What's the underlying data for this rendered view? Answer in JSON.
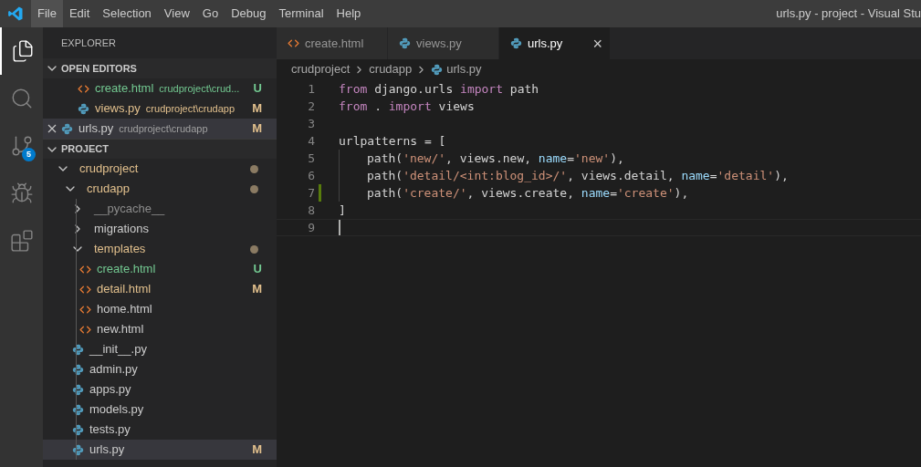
{
  "menu": [
    {
      "label": "File",
      "selected": true
    },
    {
      "label": "Edit",
      "selected": false
    },
    {
      "label": "Selection",
      "selected": false
    },
    {
      "label": "View",
      "selected": false
    },
    {
      "label": "Go",
      "selected": false
    },
    {
      "label": "Debug",
      "selected": false
    },
    {
      "label": "Terminal",
      "selected": false
    },
    {
      "label": "Help",
      "selected": false
    }
  ],
  "window": {
    "title": "urls.py - project - Visual Stu"
  },
  "activity": [
    {
      "kind": "files",
      "selected": true
    },
    {
      "kind": "search",
      "selected": false
    },
    {
      "kind": "scm",
      "selected": false,
      "badge": "5"
    },
    {
      "kind": "debug",
      "selected": false
    },
    {
      "kind": "extensions",
      "selected": false
    }
  ],
  "explorer": {
    "title": "EXPLORER",
    "open_editors": {
      "title": "OPEN EDITORS",
      "expanded": true,
      "items": [
        {
          "name": "create.html",
          "path": "crudproject\\crud...",
          "kind": "html",
          "color": "#73c991",
          "badge": "U",
          "selected": false,
          "closable": false
        },
        {
          "name": "views.py",
          "path": "crudproject\\crudapp",
          "kind": "python",
          "color": "#e2c08d",
          "badge": "M",
          "selected": false,
          "closable": false
        },
        {
          "name": "urls.py",
          "path": "crudproject\\crudapp",
          "kind": "python",
          "color": "#cccccc",
          "badge": "M",
          "selected": true,
          "closable": true
        }
      ]
    },
    "project": {
      "title": "PROJECT",
      "expanded": true,
      "tree": [
        {
          "name": "crudproject",
          "kind": "folder",
          "expanded": true,
          "color": "#e2c08d",
          "dot": true,
          "selected": false,
          "children": [
            {
              "name": "crudapp",
              "kind": "folder",
              "expanded": true,
              "color": "#e2c08d",
              "dot": true,
              "selected": false,
              "children": [
                {
                  "name": "__pycache__",
                  "kind": "folder",
                  "expanded": false,
                  "color": "#8c8c8c",
                  "dot": false,
                  "selected": false
                },
                {
                  "name": "migrations",
                  "kind": "folder",
                  "expanded": false,
                  "color": "#cccccc",
                  "dot": false,
                  "selected": false
                },
                {
                  "name": "templates",
                  "kind": "folder",
                  "expanded": true,
                  "color": "#e2c08d",
                  "dot": true,
                  "selected": false,
                  "children": [
                    {
                      "name": "create.html",
                      "kind": "html",
                      "color": "#73c991",
                      "badge": "U",
                      "selected": false
                    },
                    {
                      "name": "detail.html",
                      "kind": "html",
                      "color": "#e2c08d",
                      "badge": "M",
                      "selected": false
                    },
                    {
                      "name": "home.html",
                      "kind": "html",
                      "color": "#cccccc",
                      "selected": false
                    },
                    {
                      "name": "new.html",
                      "kind": "html",
                      "color": "#cccccc",
                      "selected": false
                    }
                  ]
                },
                {
                  "name": "__init__.py",
                  "kind": "python",
                  "color": "#cccccc",
                  "selected": false
                },
                {
                  "name": "admin.py",
                  "kind": "python",
                  "color": "#cccccc",
                  "selected": false
                },
                {
                  "name": "apps.py",
                  "kind": "python",
                  "color": "#cccccc",
                  "selected": false
                },
                {
                  "name": "models.py",
                  "kind": "python",
                  "color": "#cccccc",
                  "selected": false
                },
                {
                  "name": "tests.py",
                  "kind": "python",
                  "color": "#cccccc",
                  "selected": false
                },
                {
                  "name": "urls.py",
                  "kind": "python",
                  "color": "#cccccc",
                  "badge": "M",
                  "selected": true
                }
              ]
            }
          ]
        }
      ]
    }
  },
  "tabs": [
    {
      "label": "create.html",
      "kind": "html",
      "selected": false
    },
    {
      "label": "views.py",
      "kind": "python",
      "selected": false
    },
    {
      "label": "urls.py",
      "kind": "python",
      "selected": true,
      "close": "×"
    }
  ],
  "breadcrumb": [
    {
      "label": "crudproject",
      "kind": "folder"
    },
    {
      "label": "crudapp",
      "kind": "folder"
    },
    {
      "label": "urls.py",
      "kind": "python"
    }
  ],
  "code": [
    {
      "number": "1",
      "changed": false,
      "indent": false,
      "tokens": [
        {
          "kind": "keyword",
          "text": "from"
        },
        {
          "kind": "plain",
          "text": " django.urls "
        },
        {
          "kind": "keyword",
          "text": "import"
        },
        {
          "kind": "plain",
          "text": " path"
        }
      ]
    },
    {
      "number": "2",
      "changed": false,
      "indent": false,
      "tokens": [
        {
          "kind": "keyword",
          "text": "from"
        },
        {
          "kind": "plain",
          "text": " . "
        },
        {
          "kind": "keyword",
          "text": "import"
        },
        {
          "kind": "plain",
          "text": " views"
        }
      ]
    },
    {
      "number": "3",
      "changed": false,
      "indent": false
    },
    {
      "number": "4",
      "changed": false,
      "indent": false,
      "tokens": [
        {
          "kind": "plain",
          "text": "urlpatterns = ["
        }
      ]
    },
    {
      "number": "5",
      "changed": false,
      "indent": true,
      "tokens": [
        {
          "kind": "plain",
          "text": "path("
        },
        {
          "kind": "string",
          "text": "'new/'"
        },
        {
          "kind": "plain",
          "text": ", views.new, "
        },
        {
          "kind": "param",
          "text": "name"
        },
        {
          "kind": "plain",
          "text": "="
        },
        {
          "kind": "string",
          "text": "'new'"
        },
        {
          "kind": "plain",
          "text": "),"
        }
      ]
    },
    {
      "number": "6",
      "changed": false,
      "indent": true,
      "tokens": [
        {
          "kind": "plain",
          "text": "path("
        },
        {
          "kind": "string",
          "text": "'detail/<int:blog_id>/'"
        },
        {
          "kind": "plain",
          "text": ", views.detail, "
        },
        {
          "kind": "param",
          "text": "name"
        },
        {
          "kind": "plain",
          "text": "="
        },
        {
          "kind": "string",
          "text": "'detail'"
        },
        {
          "kind": "plain",
          "text": "),"
        }
      ]
    },
    {
      "number": "7",
      "changed": true,
      "indent": true,
      "tokens": [
        {
          "kind": "plain",
          "text": "path("
        },
        {
          "kind": "string",
          "text": "'create/'"
        },
        {
          "kind": "plain",
          "text": ", views.create, "
        },
        {
          "kind": "param",
          "text": "name"
        },
        {
          "kind": "plain",
          "text": "="
        },
        {
          "kind": "string",
          "text": "'create'"
        },
        {
          "kind": "plain",
          "text": "),"
        }
      ]
    },
    {
      "number": "8",
      "changed": false,
      "indent": false,
      "tokens": [
        {
          "kind": "plain",
          "text": "]"
        }
      ]
    },
    {
      "number": "9",
      "changed": false,
      "indent": false,
      "current": true
    }
  ]
}
